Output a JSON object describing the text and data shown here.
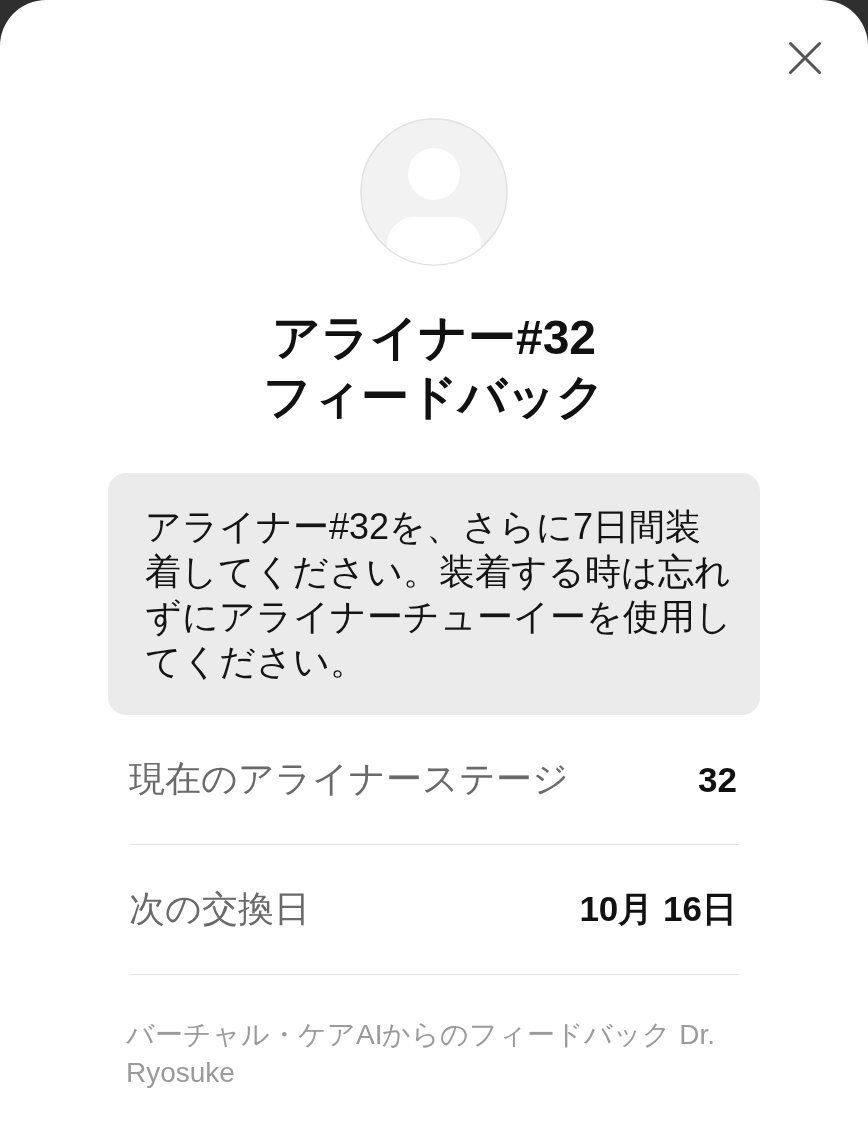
{
  "title": "アライナー#32\nフィードバック",
  "message": "アライナー#32を、さらに7日間装着してください。装着する時は忘れずにアライナーチューイーを使用してください。",
  "details": [
    {
      "label": "現在のアライナーステージ",
      "value": "32"
    },
    {
      "label": "次の交換日",
      "value": "10月 16日"
    }
  ],
  "footer": "バーチャル・ケアAIからのフィードバック Dr. Ryosuke"
}
